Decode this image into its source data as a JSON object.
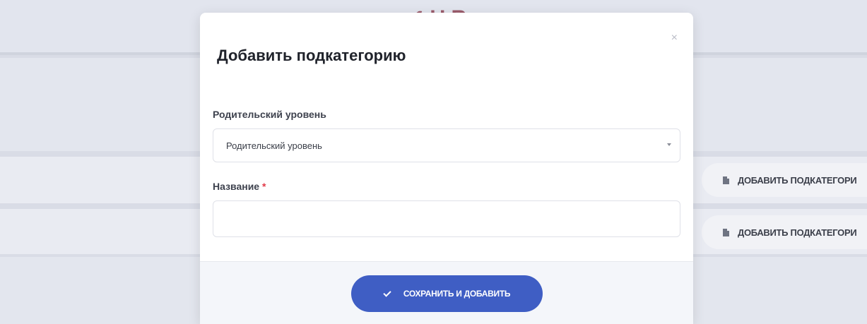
{
  "background": {
    "row_buttons": [
      {
        "label": "ДОБАВИТЬ ПОДКАТЕГОРИ"
      },
      {
        "label": "ДОБАВИТЬ ПОДКАТЕГОРИ"
      }
    ]
  },
  "modal": {
    "title": "Добавить подкатегорию",
    "close_symbol": "×",
    "parent_level": {
      "label": "Родительский уровень",
      "selected_value": "Родительский уровень"
    },
    "name_field": {
      "label": "Название",
      "required_mark": "*",
      "value": ""
    },
    "save_button_label": "СОХРАНИТЬ И ДОБАВИТЬ"
  },
  "colors": {
    "accent": "#3f5ec4",
    "required": "#e23b4a"
  },
  "icons": [
    "close-icon",
    "check-icon",
    "document-icon",
    "chevron-down-icon"
  ]
}
